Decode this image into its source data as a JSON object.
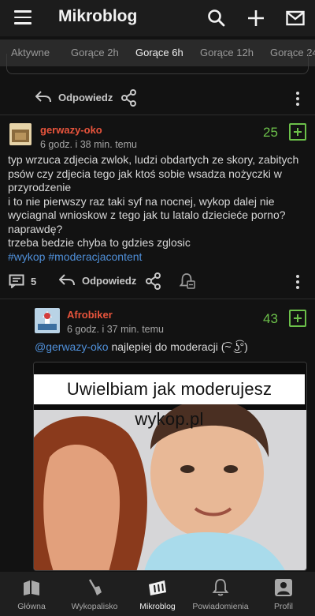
{
  "header": {
    "title": "Mikroblog",
    "icons": [
      "menu-icon",
      "search-icon",
      "plus-icon",
      "mail-icon"
    ]
  },
  "tabs": [
    {
      "label": "Aktywne",
      "active": false
    },
    {
      "label": "Gorące 2h",
      "active": false
    },
    {
      "label": "Gorące 6h",
      "active": true
    },
    {
      "label": "Gorące 12h",
      "active": false
    },
    {
      "label": "Gorące 24",
      "active": false
    }
  ],
  "prev_entry": {
    "reply_label": "Odpowiedz"
  },
  "entry": {
    "username": "gerwazy-oko",
    "timestamp": "6 godz. i 38 min. temu",
    "score": "25",
    "lines": [
      "typ wrzuca zdjecia zwlok, ludzi obdartych ze skory, zabitych psów czy zdjecia tego jak ktoś sobie wsadza nożyczki w przyrodzenie",
      "i to nie pierwszy raz taki syf na nocnej, wykop dalej nie wyciagnal wnioskow z tego jak tu latalo dziecieće porno? naprawdę?",
      "trzeba bedzie chyba to gdzies zglosic"
    ],
    "tags": [
      "#wykop",
      "#moderacjacontent"
    ],
    "comments_count": "5",
    "reply_label": "Odpowiedz"
  },
  "reply": {
    "username": "Afrobiker",
    "timestamp": "6 godz. i 37 min. temu",
    "score": "43",
    "mention": "@gerwazy-oko",
    "text": " najlepiej do moderacji (͡~ ͜ʖ͡°)",
    "image_caption": "Uwielbiam jak moderujesz wykop.pl"
  },
  "bottom_nav": [
    {
      "label": "Główna",
      "icon": "home-icon",
      "active": false
    },
    {
      "label": "Wykopalisko",
      "icon": "shovel-icon",
      "active": false
    },
    {
      "label": "Mikroblog",
      "icon": "mikroblog-icon",
      "active": true
    },
    {
      "label": "Powiadomienia",
      "icon": "bell-icon",
      "active": false
    },
    {
      "label": "Profil",
      "icon": "profile-icon",
      "active": false
    }
  ],
  "colors": {
    "background": "#121212",
    "username": "#e8543c",
    "score": "#6cc04a",
    "link": "#4f8fd8"
  }
}
